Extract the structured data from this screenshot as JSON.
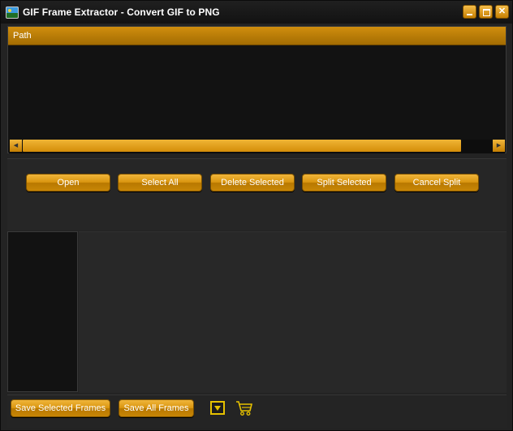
{
  "window": {
    "title": "GIF Frame Extractor - Convert GIF to PNG"
  },
  "pathlist": {
    "column_header": "Path"
  },
  "toolbar": {
    "open": "Open",
    "select_all": "Select All",
    "delete_selected": "Delete Selected",
    "split_selected": "Split Selected",
    "cancel_split": "Cancel Split"
  },
  "bottom": {
    "save_selected": "Save Selected Frames",
    "save_all": "Save All Frames"
  },
  "icons": {
    "app": "app-image-icon",
    "minimize": "minimize-icon",
    "maximize": "maximize-icon",
    "close": "close-icon",
    "dropdown": "dropdown-arrow-icon",
    "cart": "shopping-cart-icon"
  },
  "colors": {
    "accent": "#d9950f",
    "icon_yellow": "#e6c100",
    "background": "#232323"
  }
}
